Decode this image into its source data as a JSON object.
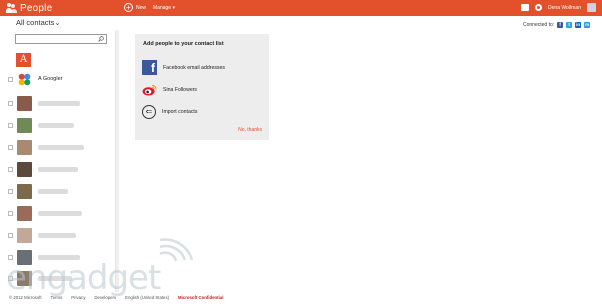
{
  "topbar": {
    "app_title": "People",
    "new_label": "New",
    "manage_label": "Manage ▾",
    "user_name": "Dena Wolfman"
  },
  "filter": {
    "label": "All contacts"
  },
  "search": {
    "placeholder": ""
  },
  "contacts": {
    "group_letter": "A",
    "first_name": "A Googler",
    "rows": 10
  },
  "card": {
    "title": "Add people to your contact list",
    "options": [
      {
        "label": "Facebook email addresses",
        "icon": "facebook-icon"
      },
      {
        "label": "Sina Followers",
        "icon": "weibo-icon"
      },
      {
        "label": "Import contacts",
        "icon": "import-icon"
      }
    ],
    "no_thanks": "No, thanks"
  },
  "connected": {
    "label": "Connected to:",
    "services": [
      "facebook",
      "twitter",
      "linkedin",
      "messenger"
    ]
  },
  "watermark": {
    "text": "engadget"
  },
  "footer": {
    "items": [
      "© 2012 Microsoft",
      "Terms",
      "Privacy",
      "Developers",
      "English (United States)"
    ],
    "confidential": "Microsoft Confidential"
  },
  "colors": {
    "accent": "#e2502c",
    "facebook": "#3b5998",
    "card_bg": "#ededed"
  }
}
